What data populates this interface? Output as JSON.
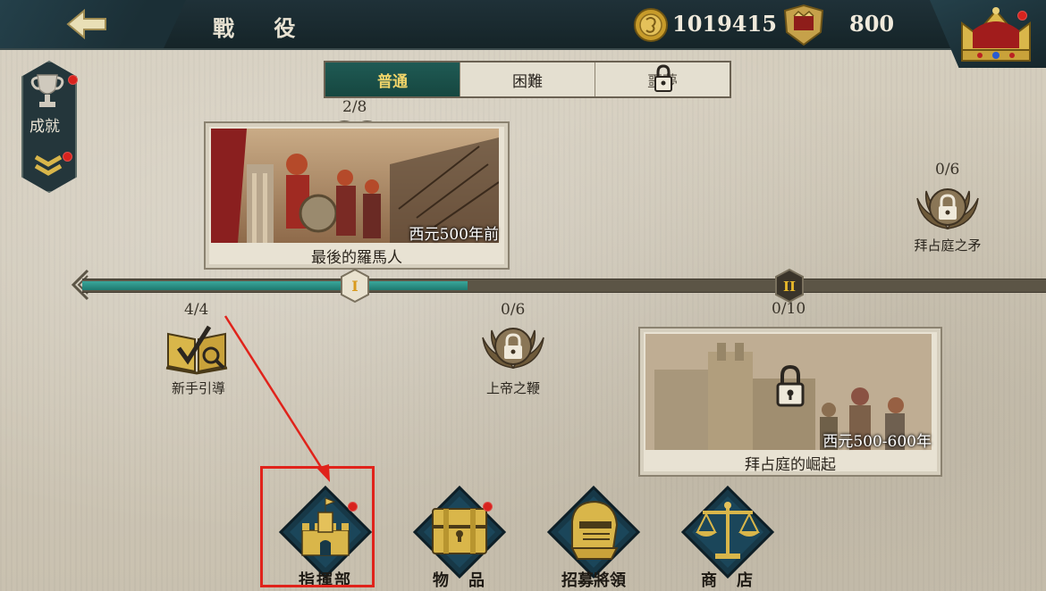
{
  "header": {
    "title": "戰 役",
    "coins": "1019415",
    "rank_points": "800"
  },
  "side_panel": {
    "achievements_label": "成就"
  },
  "difficulty_tabs": [
    {
      "label": "普通",
      "active": true,
      "locked": false
    },
    {
      "label": "困難",
      "active": false,
      "locked": false
    },
    {
      "label": "噩夢",
      "active": false,
      "locked": true
    }
  ],
  "campaigns": [
    {
      "progress": "2/8",
      "era": "西元500年前",
      "title": "最後的羅馬人"
    },
    {
      "progress": "0/10",
      "era": "西元500-600年",
      "title": "拜占庭的崛起"
    }
  ],
  "timeline": {
    "markers": [
      "I",
      "II"
    ],
    "fill_fraction": 0.4
  },
  "nodes": [
    {
      "progress": "4/4",
      "label": "新手引導",
      "icon": "book-check-icon"
    },
    {
      "progress": "0/6",
      "label": "上帝之鞭",
      "icon": "laurel-lock-icon"
    },
    {
      "progress": "0/6",
      "label": "拜占庭之矛",
      "icon": "laurel-lock-icon"
    }
  ],
  "bottom_menu": [
    {
      "label": "指揮部",
      "icon": "castle-icon",
      "badge": true
    },
    {
      "label": "物　品",
      "icon": "chest-icon",
      "badge": true
    },
    {
      "label": "招募將領",
      "icon": "knight-helmet-icon",
      "badge": false
    },
    {
      "label": "商　店",
      "icon": "scales-icon",
      "badge": false
    }
  ],
  "colors": {
    "accent_gold": "#d9b64a",
    "teal": "#2a9488",
    "dark_panel": "#1c2e34",
    "annotation_red": "#e0231b"
  }
}
